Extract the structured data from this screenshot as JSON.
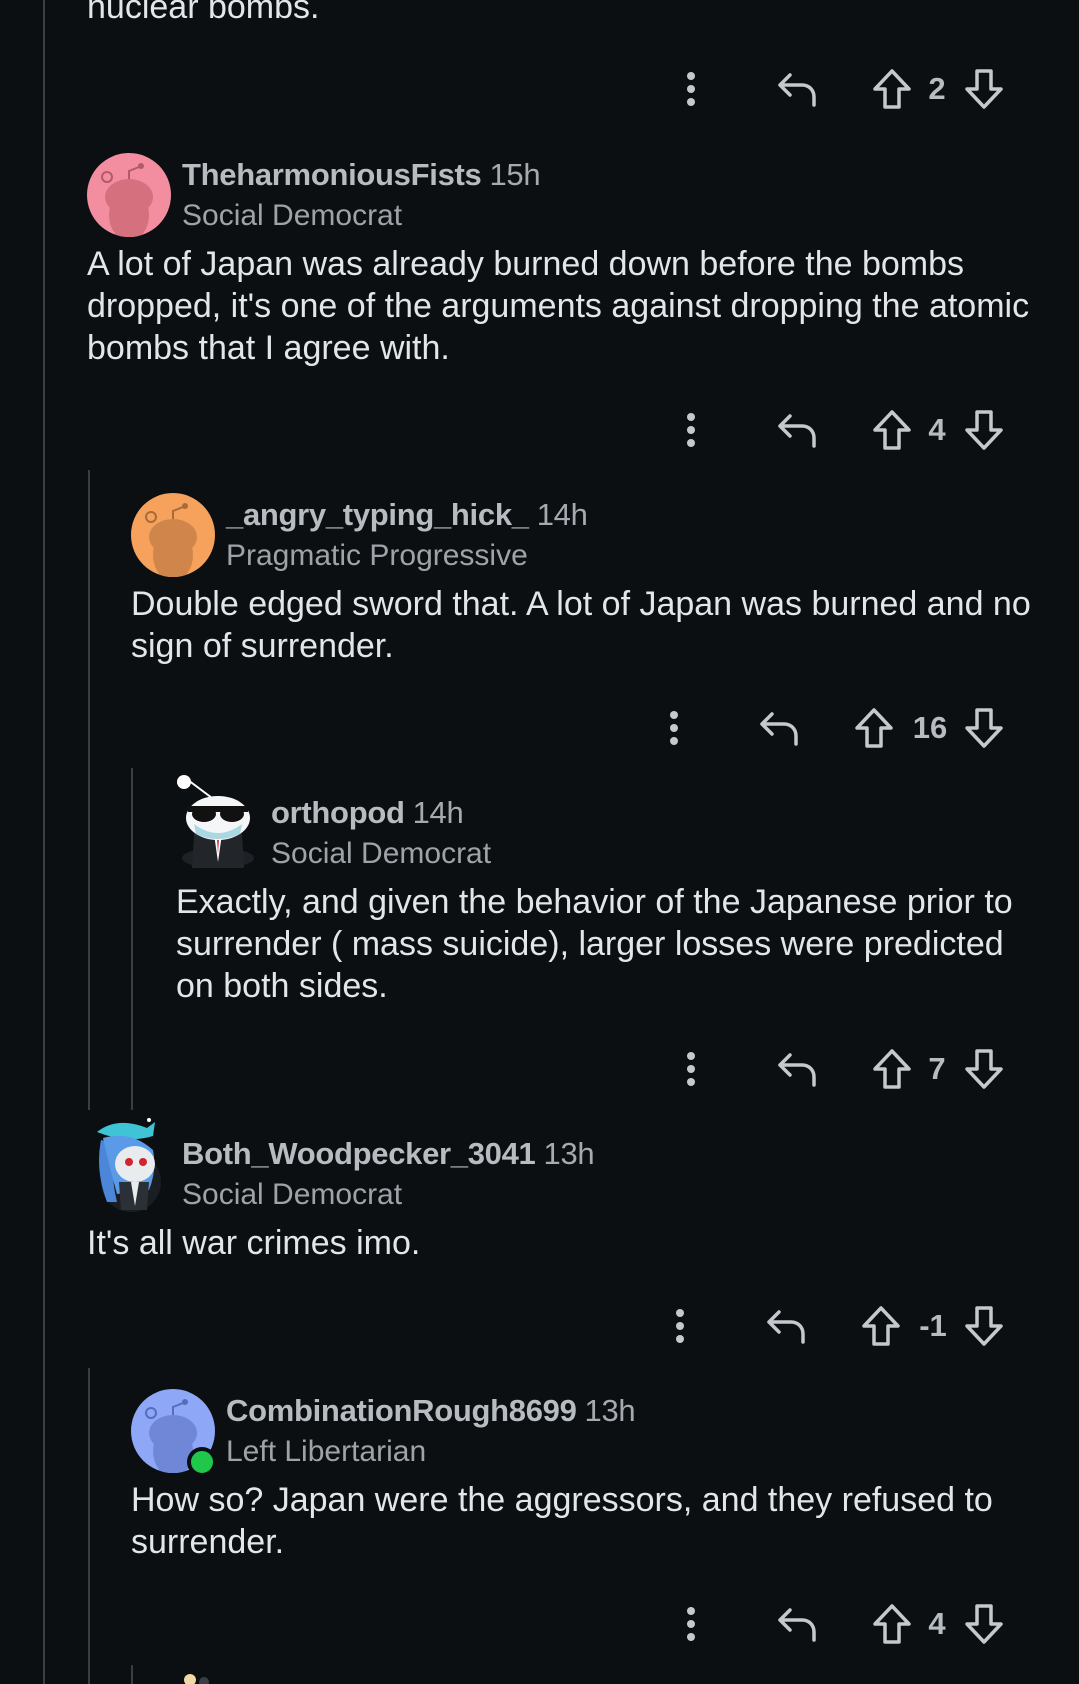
{
  "top_fragment": {
    "text": "nuclear bombs."
  },
  "first_actions": {
    "score": "2"
  },
  "comments": [
    {
      "username": "TheharmoniousFists",
      "age": "15h",
      "flair": "Social Democrat",
      "body": "A lot of Japan was already burned down before the bombs dropped, it's one of the arguments against dropping the atomic bombs that I agree with.",
      "score": "4",
      "avatar_color": "#f38ea0",
      "avatar_icon": "snoo-avatar-icon"
    },
    {
      "username": "_angry_typing_hick_",
      "age": "14h",
      "flair": "Pragmatic Progressive",
      "body": "Double edged sword that. A lot of Japan was burned and no sign of surrender.",
      "score": "16",
      "avatar_color": "#f6a25c",
      "avatar_icon": "snoo-avatar-icon"
    },
    {
      "username": "orthopod",
      "age": "14h",
      "flair": "Social Democrat",
      "body": "Exactly, and given the behavior of the Japanese prior to surrender ( mass suicide), larger losses were predicted on both sides.",
      "score": "7",
      "avatar_icon": "sunglasses-snoo-avatar-icon"
    },
    {
      "username": "Both_Woodpecker_3041",
      "age": "13h",
      "flair": "Social Democrat",
      "body": "It's all war crimes imo.",
      "score": "-1",
      "avatar_icon": "custom-snoo-avatar-icon"
    },
    {
      "username": "CombinationRough8699",
      "age": "13h",
      "flair": "Left Libertarian",
      "body": "How so? Japan were the aggressors, and they refused to surrender.",
      "score": "4",
      "avatar_color": "#8fa7f7",
      "avatar_icon": "snoo-avatar-icon",
      "online": true
    }
  ],
  "icons": {
    "more": "more-vertical-icon",
    "reply": "reply-icon",
    "upvote": "upvote-icon",
    "downvote": "downvote-icon"
  },
  "colors": {
    "background": "#0b0f12",
    "thread_line": "#3a3e42",
    "online": "#1fc74b"
  }
}
